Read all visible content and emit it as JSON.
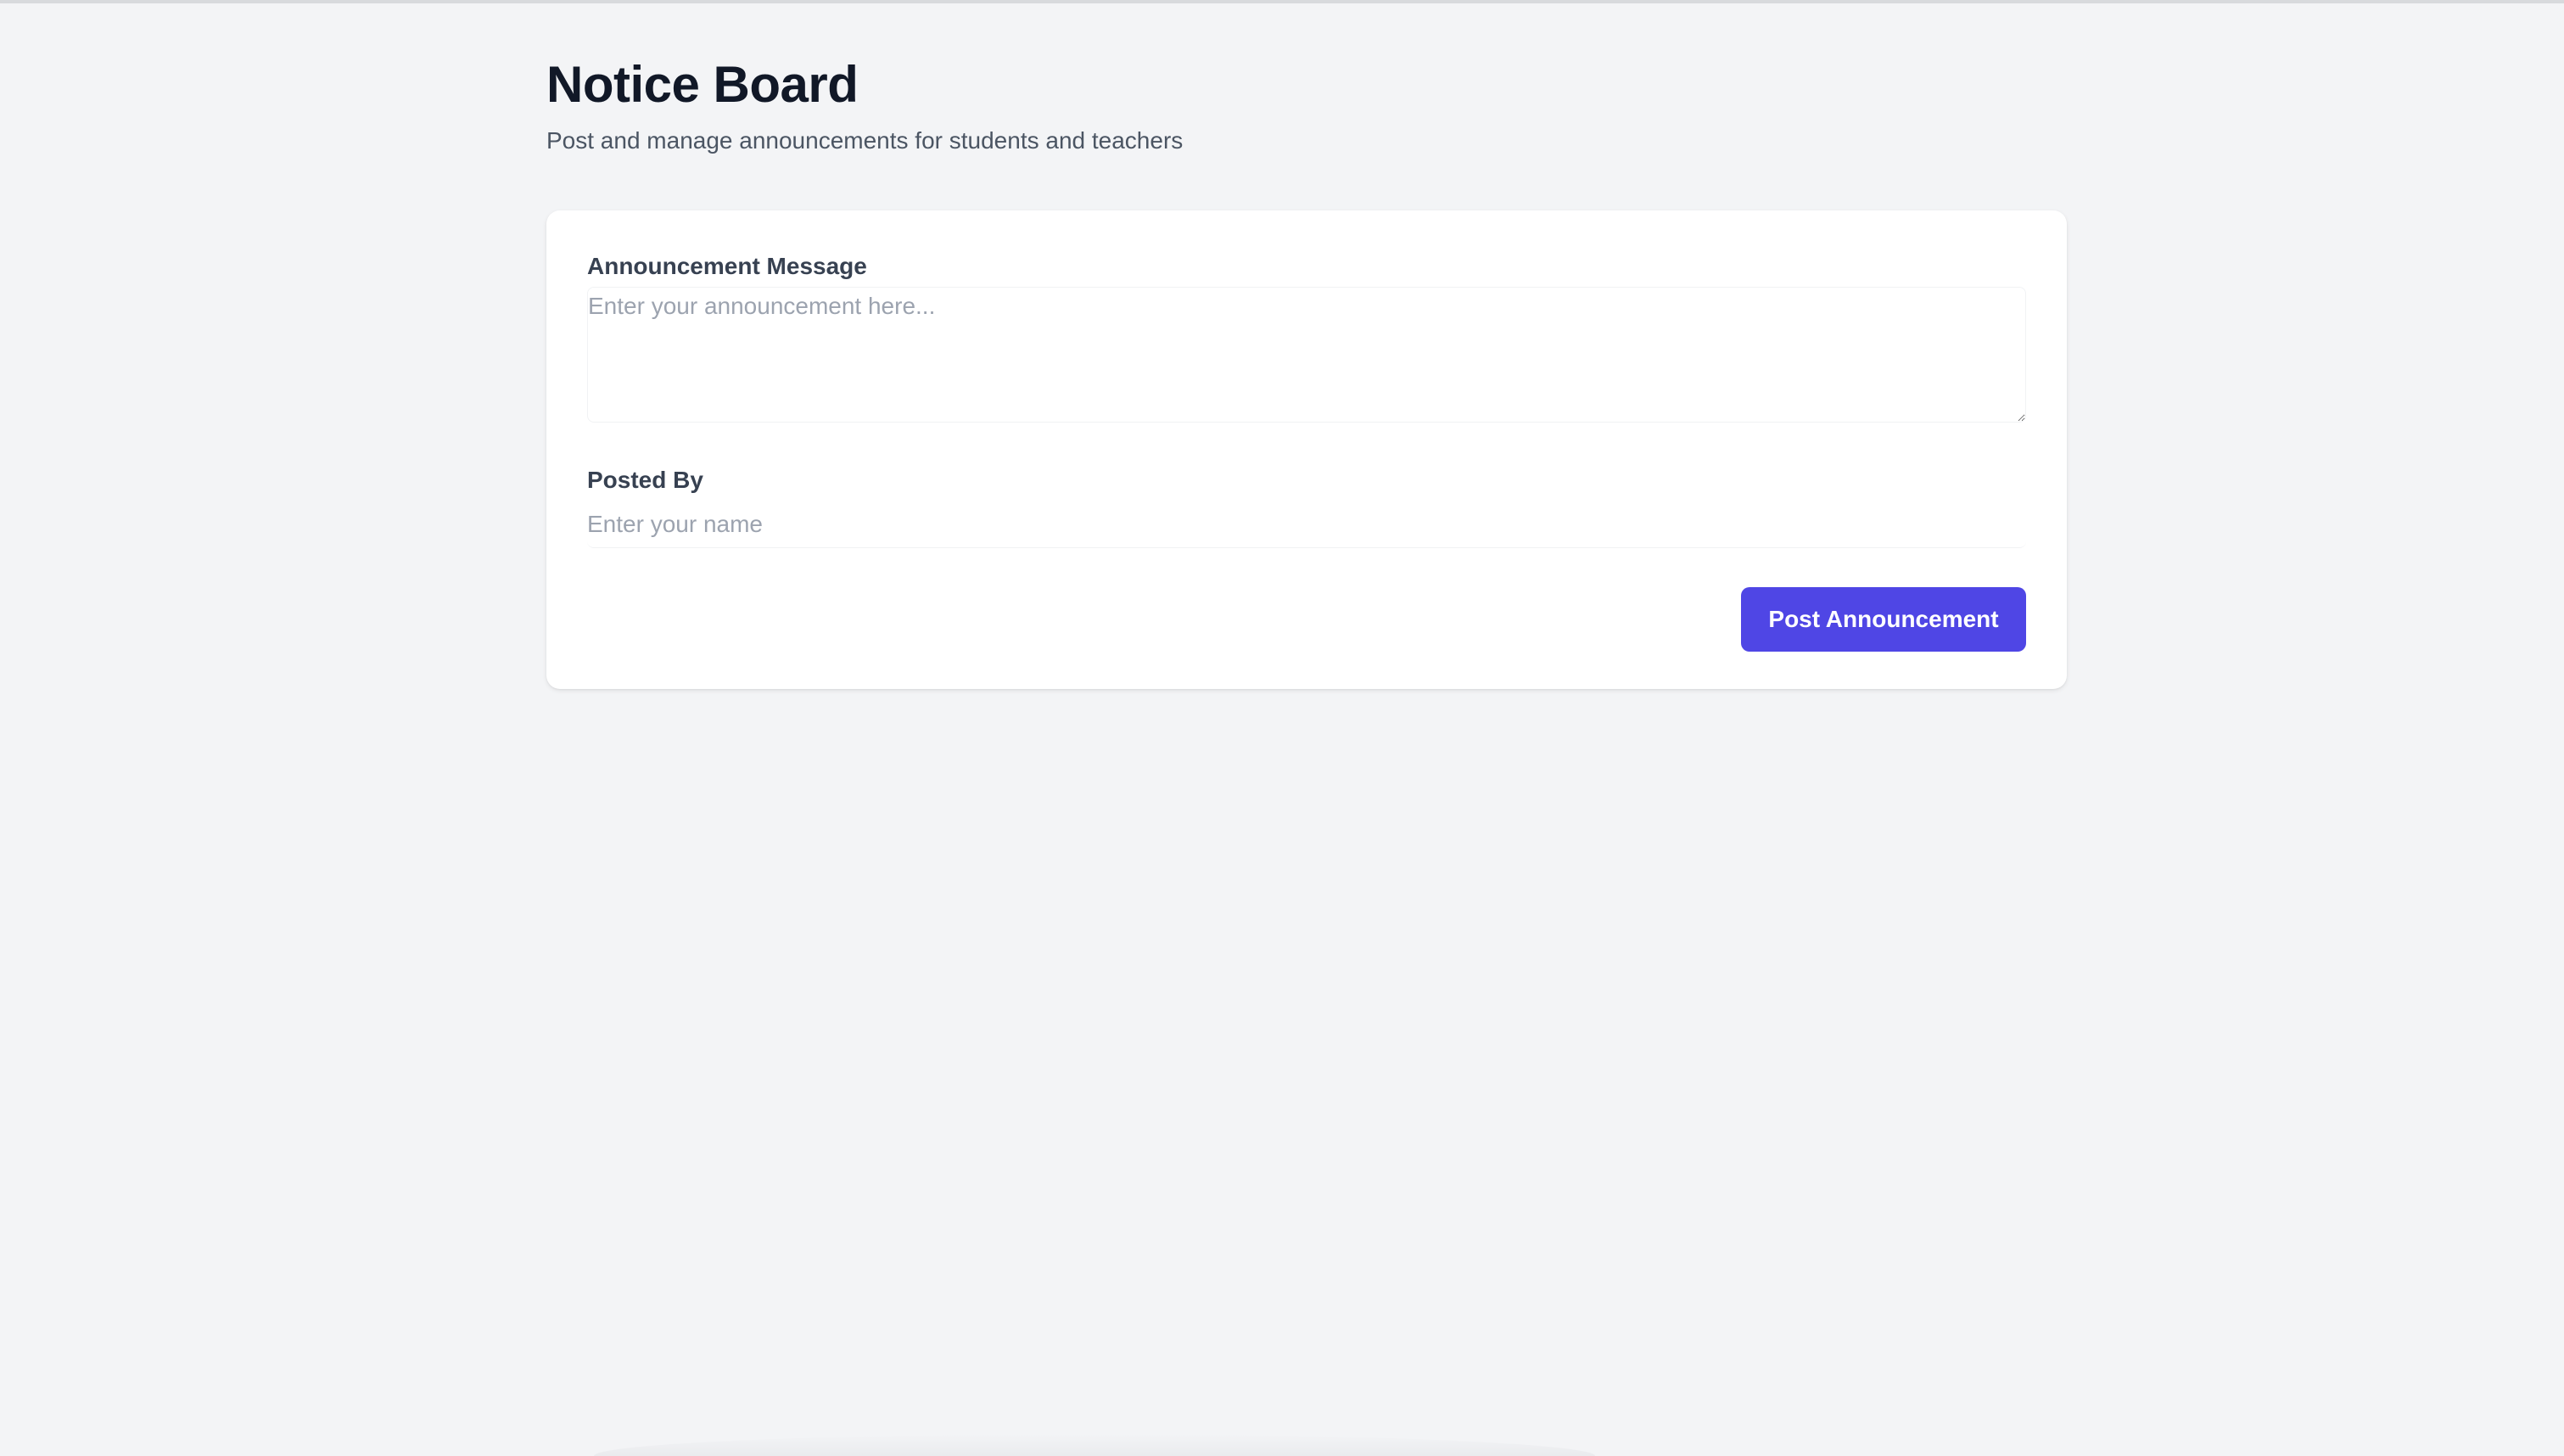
{
  "header": {
    "title": "Notice Board",
    "subtitle": "Post and manage announcements for students and teachers"
  },
  "form": {
    "message": {
      "label": "Announcement Message",
      "placeholder": "Enter your announcement here...",
      "value": ""
    },
    "posted_by": {
      "label": "Posted By",
      "placeholder": "Enter your name",
      "value": ""
    },
    "submit_label": "Post Announcement"
  },
  "colors": {
    "background": "#f3f4f6",
    "card": "#ffffff",
    "accent": "#4f46e5",
    "title": "#111827",
    "subtitle": "#4b5563",
    "placeholder": "#9ca3af"
  },
  "icons": {
    "textarea_resize": "resize-handle-icon"
  }
}
